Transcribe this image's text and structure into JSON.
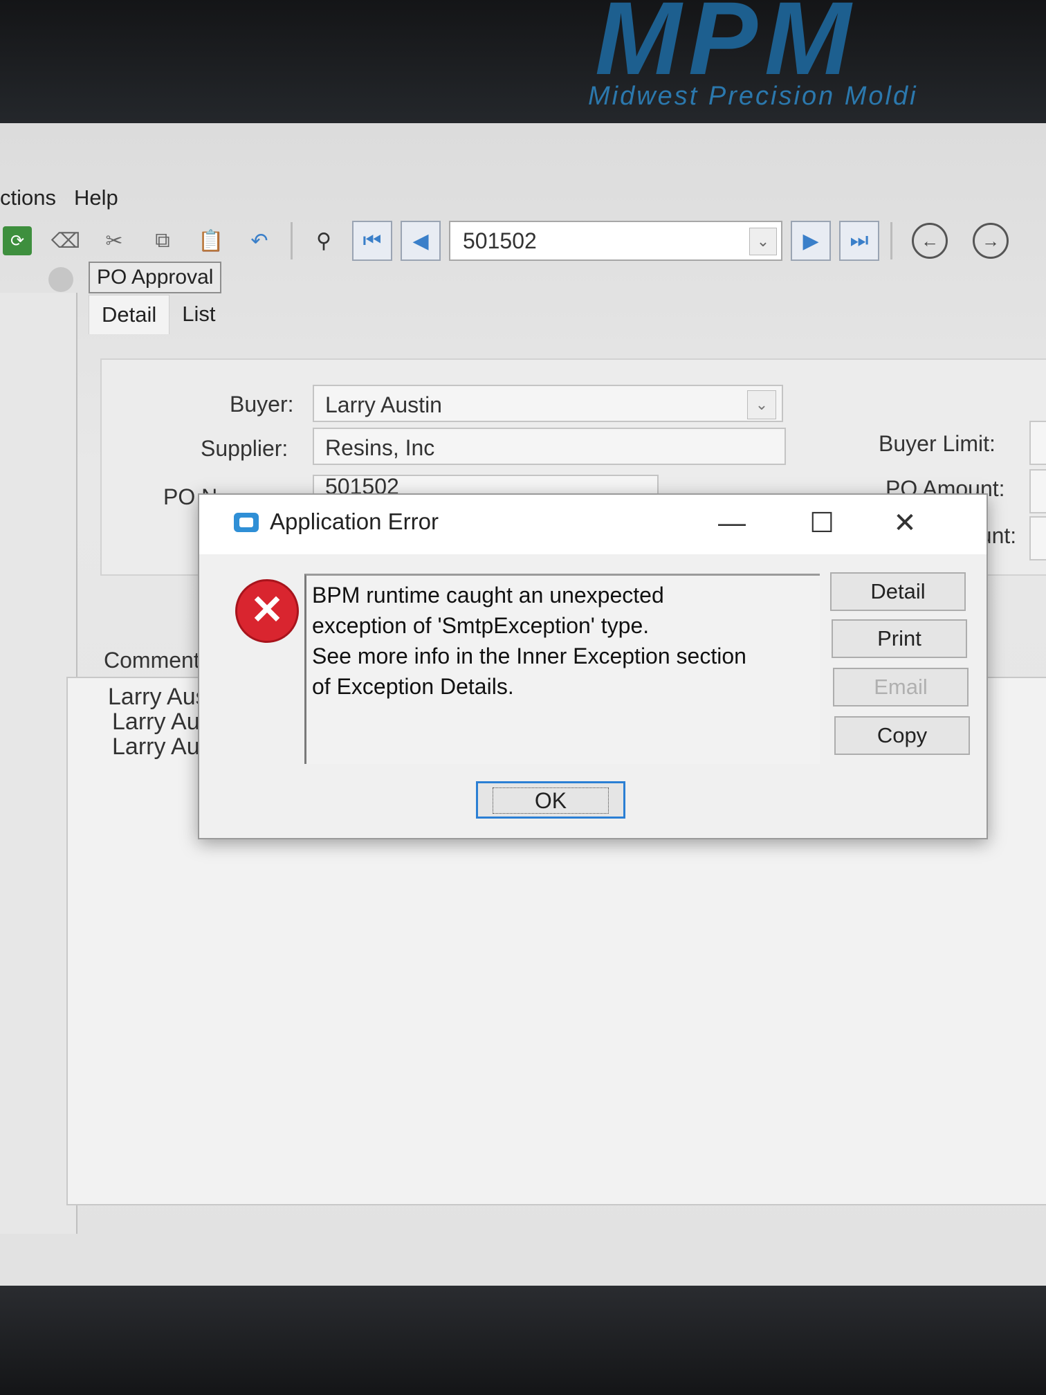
{
  "wallpaper": {
    "logo": "MPM",
    "tagline": "Midwest Precision Moldi"
  },
  "menu": [
    "ctions",
    "Help"
  ],
  "toolbar": {
    "record_value": "501502"
  },
  "form": {
    "title": "PO Approval",
    "tabs": [
      {
        "label": "Detail",
        "active": true
      },
      {
        "label": "List",
        "active": false
      }
    ],
    "buyer_label": "Buyer:",
    "buyer_value": "Larry Austin",
    "supplier_label": "Supplier:",
    "supplier_value": "Resins, Inc",
    "po_number_label": "PO N",
    "po_number_value": "501502",
    "buyer_limit_label": "Buyer Limit:",
    "po_amount_label": "PO Amount:",
    "amount_label": "ount:",
    "comments_label": "Comments",
    "comments": [
      "Larry Aus",
      "Larry Aus",
      "Larry Aus"
    ]
  },
  "dialog": {
    "title": "Application Error",
    "message_lines": [
      "BPM runtime caught an unexpected",
      "exception of 'SmtpException' type.",
      "See more info in the Inner Exception section",
      "of Exception Details."
    ],
    "buttons": {
      "detail": "Detail",
      "print": "Print",
      "email": "Email",
      "copy": "Copy",
      "ok": "OK"
    }
  },
  "colors": {
    "error_red": "#d9252f",
    "focus_blue": "#2b7fd4",
    "nav_blue": "#3a7fc9"
  }
}
